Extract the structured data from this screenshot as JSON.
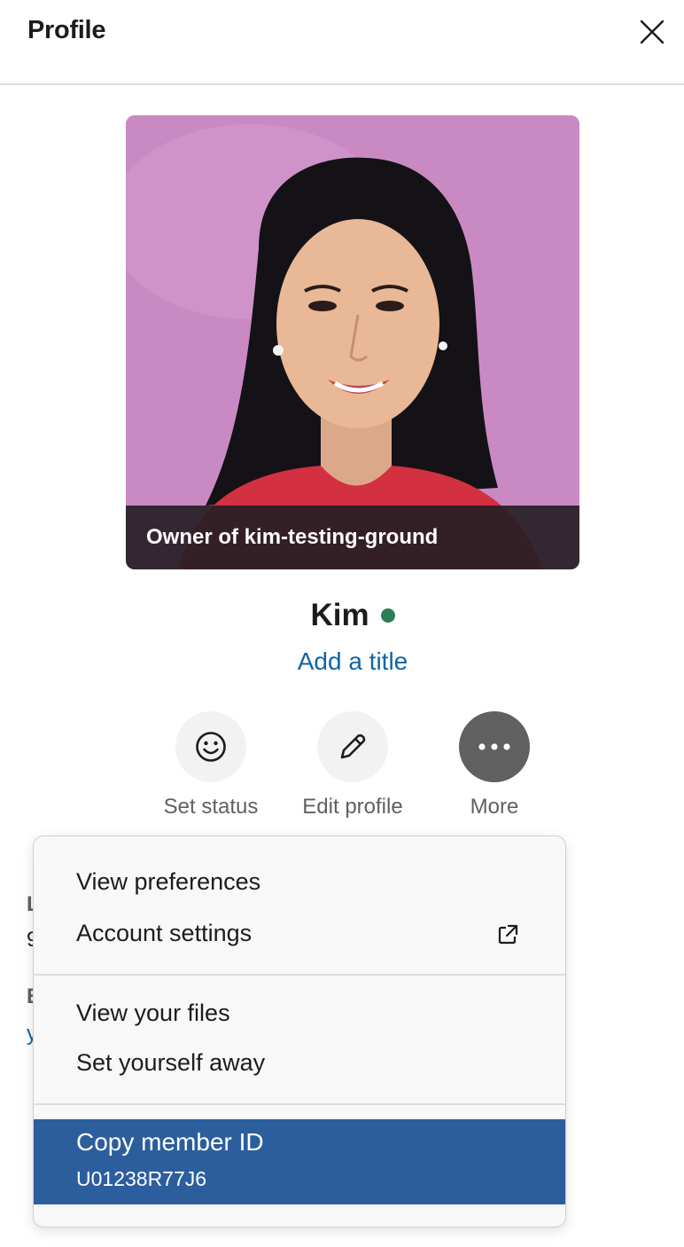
{
  "header": {
    "title": "Profile"
  },
  "profile": {
    "caption": "Owner of kim-testing-ground",
    "name": "Kim",
    "add_title": "Add a title",
    "presence_color": "#2e7d57"
  },
  "actions": [
    {
      "label": "Set status",
      "icon": "smiley-icon"
    },
    {
      "label": "Edit profile",
      "icon": "pencil-icon"
    },
    {
      "label": "More",
      "icon": "ellipsis-icon"
    }
  ],
  "background": {
    "label1": "L",
    "text1": "9",
    "label2": "E",
    "link2": "y"
  },
  "menu": {
    "view_preferences": "View preferences",
    "account_settings": "Account settings",
    "view_files": "View your files",
    "set_away": "Set yourself away",
    "copy_member_id": "Copy member ID",
    "member_id": "U01238R77J6"
  },
  "colors": {
    "accent": "#2c5e9e",
    "link": "#1264a3"
  }
}
